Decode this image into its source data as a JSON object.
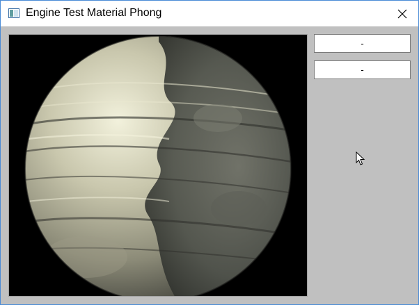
{
  "window": {
    "title": "Engine Test Material Phong",
    "icon": "app-window-icon",
    "close_icon": "close-icon"
  },
  "viewport": {
    "content": "textured-sphere-render",
    "background_color": "#000000"
  },
  "side_panel": {
    "buttons": [
      {
        "label": "-"
      },
      {
        "label": "-"
      }
    ]
  },
  "colors": {
    "client_background": "#c0c0c0",
    "window_border": "#4a8bd6"
  }
}
